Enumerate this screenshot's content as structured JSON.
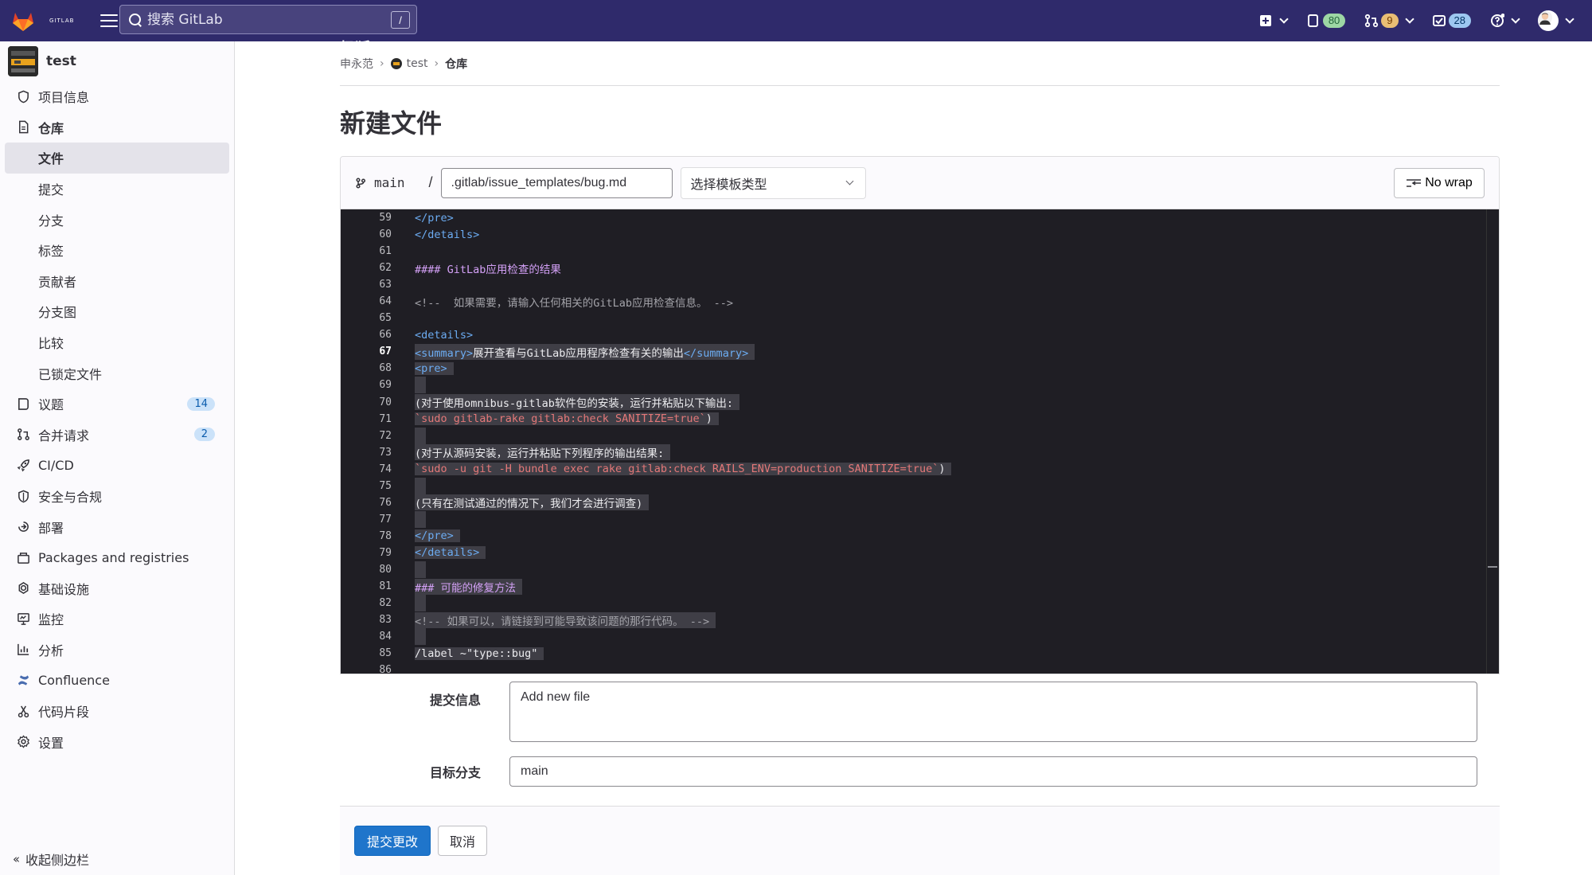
{
  "topbar": {
    "logo_main": "极狐",
    "logo_sub": "GITLAB",
    "search_placeholder": "搜索 GitLab",
    "search_shortcut": "/",
    "issues_count": "80",
    "mr_count": "9",
    "todo_count": "28",
    "colors": {
      "bg": "#2f2a6b",
      "issues_badge": "#9dd7a4",
      "mr_badge": "#e9be74",
      "todo_badge": "#9dc7f1"
    }
  },
  "sidebar": {
    "project_name": "test",
    "items": [
      {
        "label": "项目信息",
        "icon": "info-icon"
      },
      {
        "label": "仓库",
        "icon": "doc-icon"
      },
      {
        "label": "文件",
        "sub": true,
        "active": true
      },
      {
        "label": "提交",
        "sub": true
      },
      {
        "label": "分支",
        "sub": true
      },
      {
        "label": "标签",
        "sub": true
      },
      {
        "label": "贡献者",
        "sub": true
      },
      {
        "label": "分支图",
        "sub": true
      },
      {
        "label": "比较",
        "sub": true
      },
      {
        "label": "已锁定文件",
        "sub": true
      },
      {
        "label": "议题",
        "icon": "issues-icon",
        "count": "14"
      },
      {
        "label": "合并请求",
        "icon": "merge-request-icon",
        "count": "2"
      },
      {
        "label": "CI/CD",
        "icon": "rocket-icon"
      },
      {
        "label": "安全与合规",
        "icon": "shield-icon"
      },
      {
        "label": "部署",
        "icon": "deploy-icon"
      },
      {
        "label": "Packages and registries",
        "icon": "package-icon"
      },
      {
        "label": "基础设施",
        "icon": "cloud-gear-icon"
      },
      {
        "label": "监控",
        "icon": "monitor-icon"
      },
      {
        "label": "分析",
        "icon": "chart-icon"
      },
      {
        "label": "Confluence",
        "icon": "confluence-icon"
      },
      {
        "label": "代码片段",
        "icon": "snippet-icon"
      },
      {
        "label": "设置",
        "icon": "settings-icon"
      }
    ],
    "collapse_label": "收起侧边栏"
  },
  "breadcrumb": {
    "user": "申永范",
    "project": "test",
    "current": "仓库"
  },
  "page_title": "新建文件",
  "editor": {
    "branch": "main",
    "path_sep": "/",
    "file_path": ".gitlab/issue_templates/bug.md",
    "template_select": "选择模板类型",
    "nowrap_label": "No wrap",
    "current_line": 67,
    "lines": [
      {
        "n": "59",
        "t": "</pre>",
        "c": "tag"
      },
      {
        "n": "60",
        "t": "</details>",
        "c": "tag"
      },
      {
        "n": "61",
        "t": ""
      },
      {
        "n": "62",
        "t": "#### GitLab应用检查的结果",
        "c": "head"
      },
      {
        "n": "63",
        "t": ""
      },
      {
        "n": "64",
        "t": "<!--  如果需要，请输入任何相关的GitLab应用检查信息。 -->",
        "c": "comm"
      },
      {
        "n": "65",
        "t": ""
      },
      {
        "n": "66",
        "t": "<details>",
        "c": "tag"
      },
      {
        "n": "67",
        "t": "",
        "hl": true,
        "parts": [
          [
            "<summary>",
            "tag"
          ],
          [
            "展开查看与GitLab应用程序检查有关的输出",
            ""
          ],
          [
            "</summary>",
            "tag"
          ]
        ]
      },
      {
        "n": "68",
        "t": "<pre>",
        "c": "tag",
        "hl": true
      },
      {
        "n": "69",
        "t": "",
        "hl": true
      },
      {
        "n": "70",
        "t": "(对于使用omnibus-gitlab软件包的安装，运行并粘贴以下输出:",
        "hl": true
      },
      {
        "n": "71",
        "t": "",
        "hl": true,
        "parts": [
          [
            "`sudo gitlab-rake gitlab:check SANITIZE=true`",
            "str"
          ],
          [
            ")",
            ""
          ]
        ]
      },
      {
        "n": "72",
        "t": "",
        "hl": true
      },
      {
        "n": "73",
        "t": "(对于从源码安装，运行并粘贴下列程序的输出结果:",
        "hl": true
      },
      {
        "n": "74",
        "t": "",
        "hl": true,
        "parts": [
          [
            "`sudo -u git -H bundle exec rake gitlab:check RAILS_ENV=production SANITIZE=true`",
            "str"
          ],
          [
            ")",
            ""
          ]
        ]
      },
      {
        "n": "75",
        "t": "",
        "hl": true
      },
      {
        "n": "76",
        "t": "(只有在测试通过的情况下，我们才会进行调查)",
        "hl": true
      },
      {
        "n": "77",
        "t": "",
        "hl": true
      },
      {
        "n": "78",
        "t": "</pre>",
        "c": "tag",
        "hl": true
      },
      {
        "n": "79",
        "t": "</details>",
        "c": "tag",
        "hl": true
      },
      {
        "n": "80",
        "t": "",
        "hl": true
      },
      {
        "n": "81",
        "t": "### 可能的修复方法",
        "c": "head",
        "hl": true
      },
      {
        "n": "82",
        "t": "",
        "hl": true
      },
      {
        "n": "83",
        "t": "<!-- 如果可以，请链接到可能导致该问题的那行代码。 -->",
        "c": "comm",
        "hl": true
      },
      {
        "n": "84",
        "t": "",
        "hl": true
      },
      {
        "n": "85",
        "t": "/label ~\"type::bug\"",
        "hl": true
      },
      {
        "n": "86",
        "t": ""
      }
    ]
  },
  "form": {
    "commit_label": "提交信息",
    "commit_value": "Add new file",
    "branch_label": "目标分支",
    "branch_value": "main",
    "submit_label": "提交更改",
    "cancel_label": "取消"
  }
}
